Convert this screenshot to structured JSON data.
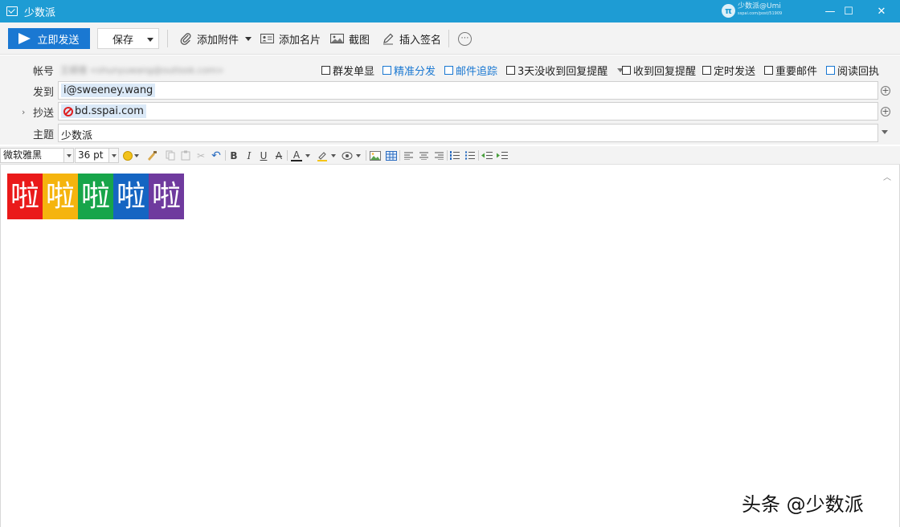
{
  "window": {
    "title": "少数派",
    "watermark_line1": "少数派@Umi",
    "watermark_line2": "sspai.com/post/51909",
    "controls": {
      "minimize": "—",
      "maximize": "☐",
      "close": "✕"
    }
  },
  "toolbar": {
    "send_label": "立即发送",
    "save_label": "保存",
    "attach_label": "添加附件",
    "card_label": "添加名片",
    "screenshot_label": "截图",
    "signature_label": "插入签名",
    "more_label": "⋯"
  },
  "header": {
    "account_label": "帐号",
    "account_value": "王顺禧 <shunyuwang@outlook.com>",
    "to_label": "发到",
    "to_value": "i@sweeney.wang",
    "cc_label": "抄送",
    "cc_value": "bd.sspai.com",
    "subject_label": "主题",
    "subject_value": "少数派",
    "options": [
      {
        "label": "群发单显",
        "checked": false,
        "accent": false
      },
      {
        "label": "精准分发",
        "checked": false,
        "accent": true
      },
      {
        "label": "邮件追踪",
        "checked": false,
        "accent": true
      },
      {
        "label": "3天没收到回复提醒",
        "checked": false,
        "accent": false
      },
      {
        "label": "收到回复提醒",
        "checked": false,
        "accent": false
      },
      {
        "label": "定时发送",
        "checked": false,
        "accent": false
      },
      {
        "label": "重要邮件",
        "checked": false,
        "accent": false
      },
      {
        "label": "阅读回执",
        "checked": false,
        "accent": false
      }
    ]
  },
  "format": {
    "font_family": "微软雅黑",
    "font_size": "36 pt",
    "bold": "B",
    "italic": "I",
    "underline": "U",
    "strike": "A",
    "font_color": "A"
  },
  "body": {
    "rainbow_words": [
      "啦",
      "啦",
      "啦",
      "啦",
      "啦"
    ],
    "rainbow_colors": [
      "#ea1a1a",
      "#f5b40e",
      "#17a54a",
      "#1565c2",
      "#6f3a9e"
    ]
  },
  "footer_watermark": "头条 @少数派"
}
